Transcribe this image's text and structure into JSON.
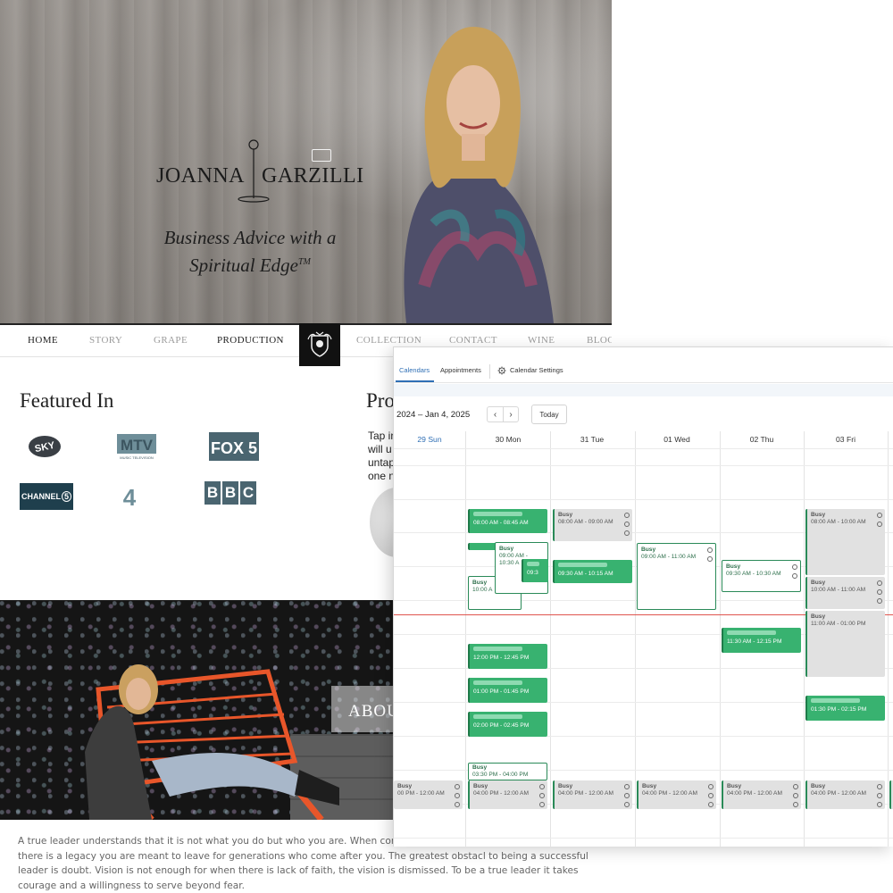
{
  "website": {
    "brand_first": "JOANNA",
    "brand_last": "GARZILLI",
    "tagline_line1": "Business Advice with a",
    "tagline_line2": "Spiritual Edge",
    "tagline_tm": "TM",
    "nav": [
      "HOME",
      "STORY",
      "GRAPE",
      "PRODUCTION",
      "COLLECTION",
      "CONTACT",
      "WINE",
      "BLOG"
    ],
    "featured_title": "Featured In",
    "logos": {
      "sky": "SKY",
      "mtv": "MTV",
      "mtv_sub": "MUSIC TELEVISION",
      "fox5": "FOX 5",
      "channel5": "CHANNEL",
      "channel5_digit": "5",
      "channel4": "4",
      "bbc": [
        "B",
        "B",
        "C"
      ]
    },
    "pro_title": "Pro",
    "pro_lines": [
      "Tap in",
      "will u",
      "untap",
      "one n"
    ],
    "about_label": "ABOU",
    "about_text": "A true leader understands that it is not what you do but who you are. When connecte unique vision. The true leader knows there is a legacy you are meant to leave for generations who come after you. The greatest obstacl to being a successful leader is doubt. Vision is not enough for when there is lack of faith, the vision is dismissed. To be a true leader it takes courage and a willingness to serve beyond fear."
  },
  "calendar": {
    "tabs": {
      "calendars": "Calendars",
      "appointments": "Appointments",
      "settings": "Calendar Settings"
    },
    "range": "2024 – Jan 4, 2025",
    "today": "Today",
    "prev_icon": "chevron-left-icon",
    "next_icon": "chevron-right-icon",
    "days": [
      "29 Sun",
      "30 Mon",
      "31 Tue",
      "01 Wed",
      "02 Thu",
      "03 Fri"
    ],
    "active_day": "29 Sun",
    "colors": {
      "accent": "#2f6fb5",
      "event_green": "#38b270",
      "event_dark": "#1f7a49",
      "busy_gray": "#e1e1e1",
      "now_line": "#e0544e"
    },
    "events": {
      "mon_0800": "08:00 AM - 08:45 AM",
      "mon_busy_title": "Busy",
      "mon_busy_0900": "09:00 AM -",
      "mon_busy_1030": "10:30 A",
      "mon_0930_short": "09:3",
      "mon_busy2_title": "Busy",
      "mon_busy2_1000": "10:00 A",
      "mon_1200": "12:00 PM - 12:45 PM",
      "mon_0100": "01:00 PM - 01:45 PM",
      "mon_0200": "02:00 PM - 02:45 PM",
      "mon_busy3_title": "Busy",
      "mon_0330": "03:30 PM - 04:00 PM",
      "tue_busy_title": "Busy",
      "tue_0800": "08:00 AM - 09:00 AM",
      "tue_0930": "09:30 AM - 10:15 AM",
      "wed_busy_title": "Busy",
      "wed_0900": "09:00 AM - 11:00 AM",
      "thu_busy_title": "Busy",
      "thu_0930": "09:30 AM - 10:30 AM",
      "thu_1130": "11:30 AM - 12:15 PM",
      "fri_busy1_title": "Busy",
      "fri_0800": "08:00 AM - 10:00 AM",
      "fri_busy2_title": "Busy",
      "fri_1000": "10:00 AM - 11:00 AM",
      "fri_busy3_title": "Busy",
      "fri_1100": "11:00 AM - 01:00 PM",
      "fri_0130": "01:30 PM - 02:15 PM",
      "sun_busy_title": "Busy",
      "sun_0400": "00 PM - 12:00 AM",
      "mon_busy4_title": "Busy",
      "mon_0400": "04:00 PM - 12:00 AM",
      "tue_busy2_title": "Busy",
      "tue_0400": "04:00 PM - 12:00 AM",
      "wed_busy2_title": "Busy",
      "wed_0400": "04:00 PM - 12:00 AM",
      "thu_busy2_title": "Busy",
      "thu_0400": "04:00 PM - 12:00 AM",
      "fri_busy4_title": "Busy",
      "fri_0400": "04:00 PM - 12:00 AM"
    }
  }
}
